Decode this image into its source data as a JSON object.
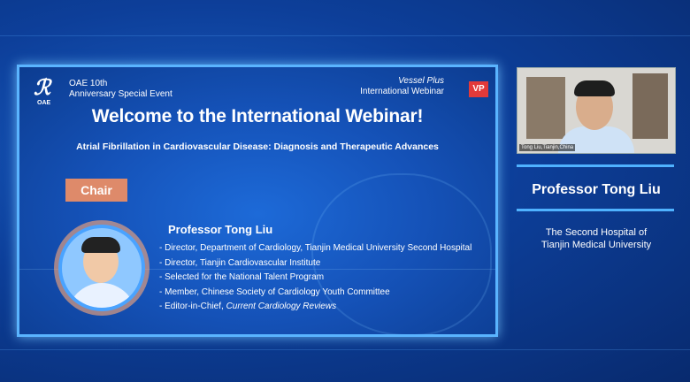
{
  "slide": {
    "logo_text": "ℛ",
    "logo_sub": "OAE",
    "event_line1": "OAE 10th",
    "event_line2": "Anniversary Special Event",
    "publisher_line1": "Vessel Plus",
    "publisher_line2": "International Webinar",
    "badge": "VP",
    "title": "Welcome to the International Webinar!",
    "subtitle": "Atrial Fibrillation in Cardiovascular Disease: Diagnosis and Therapeutic Advances",
    "role": "Chair",
    "speaker_name": "Professor Tong Liu",
    "bio": [
      "- Director, Department of Cardiology, Tianjin Medical University Second Hospital",
      "- Director, Tianjin Cardiovascular Institute",
      "- Selected for the National Talent Program",
      "- Member, Chinese Society of Cardiology Youth Committee"
    ],
    "bio_last_prefix": "- Editor-in-Chief, ",
    "bio_last_journal": "Current Cardiology Reviews"
  },
  "camera": {
    "caption": "Tong Liu,Tianjin,China"
  },
  "right_panel": {
    "name": "Professor Tong Liu",
    "affiliation_line1": "The Second Hospital of",
    "affiliation_line2": "Tianjin Medical University"
  }
}
